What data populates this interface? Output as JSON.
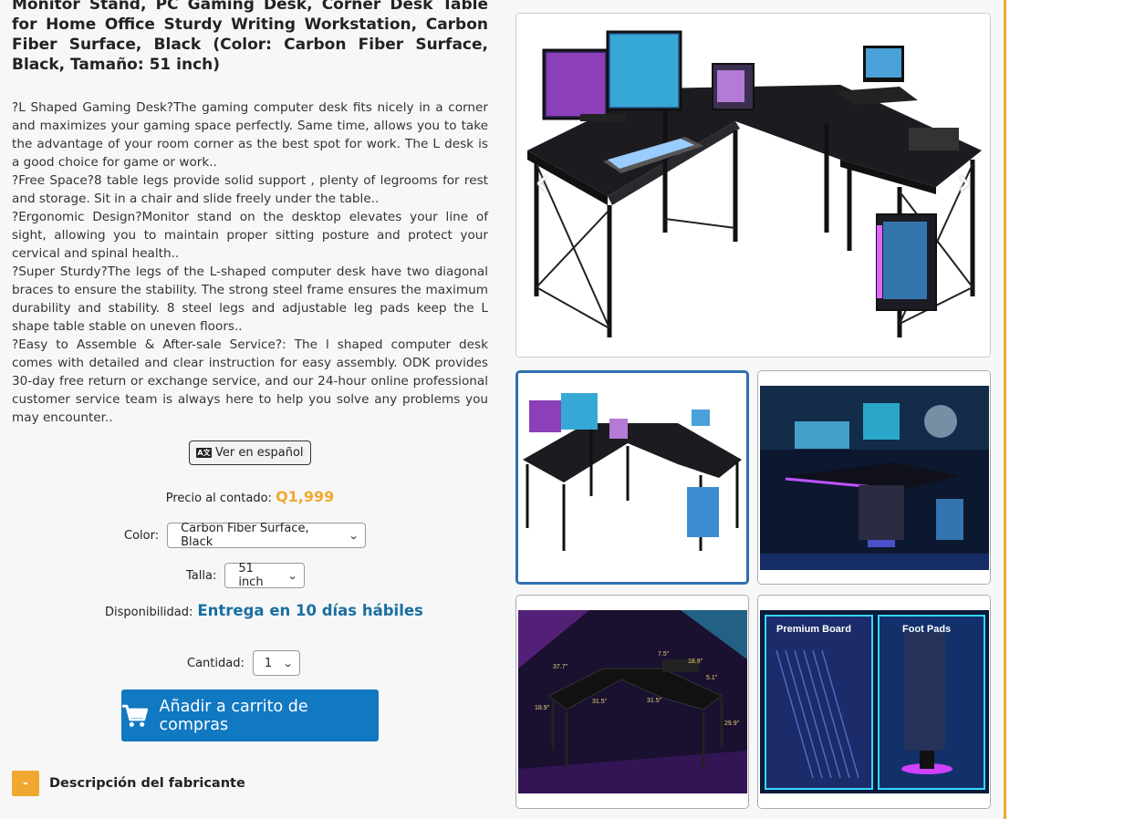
{
  "product": {
    "title": "Monitor Stand, PC Gaming Desk, Corner Desk Table for Home Office Sturdy Writing Workstation, Carbon Fiber Surface, Black (Color: Carbon Fiber Surface, Black, Tamaño: 51 inch)",
    "description": [
      "?L Shaped Gaming Desk?The gaming computer desk fits nicely in a corner and maximizes your gaming space perfectly. Same time, allows you to take the advantage of your room corner as the best spot for work. The L desk is a good choice for game or work..",
      "?Free Space?8 table legs provide solid support , plenty of legrooms for rest and storage. Sit in a chair and slide freely under the table..",
      "?Ergonomic Design?Monitor stand on the desktop elevates your line of sight, allowing you to maintain proper sitting posture and protect your cervical and spinal health..",
      "?Super Sturdy?The legs of the L-shaped computer desk have two diagonal braces to ensure the stability. The strong steel frame ensures the maximum durability and stability. 8 steel legs and adjustable leg pads keep the L shape table stable on uneven floors..",
      "?Easy to Assemble & After-sale Service?: The l shaped computer desk comes with detailed and clear instruction for easy assembly. ODK provides 30-day free return or exchange service, and our 24-hour online professional customer service team is always here to help you solve any problems you may encounter.."
    ]
  },
  "translate_button": {
    "label": "Ver en español",
    "icon": "translate-icon"
  },
  "price": {
    "label": "Precio al contado:",
    "value": "Q1,999"
  },
  "color": {
    "label": "Color:",
    "selected": "Carbon Fiber Surface, Black"
  },
  "size": {
    "label": "Talla:",
    "selected": "51 inch"
  },
  "availability": {
    "label": "Disponibilidad:",
    "value": "Entrega en 10 días hábiles"
  },
  "quantity": {
    "label": "Cantidad:",
    "selected": "1"
  },
  "cart_button": {
    "label": "Añadir a carrito de compras",
    "icon": "shopping-cart-icon"
  },
  "manufacturer": {
    "toggle": "-",
    "label": "Descripción del fabricante"
  },
  "gallery": {
    "thumb3_labels": [
      "37.7\"",
      "7.5\"",
      "18.9\"",
      "5.1\"",
      "31.5\"",
      "31.5\"",
      "18.9\"",
      "29.9\""
    ],
    "thumb4_labels": {
      "left": "Premium Board",
      "right": "Foot Pads"
    }
  },
  "colors": {
    "accent": "#f0a830",
    "primary": "#1178c2",
    "availability": "#1a6fa0"
  }
}
